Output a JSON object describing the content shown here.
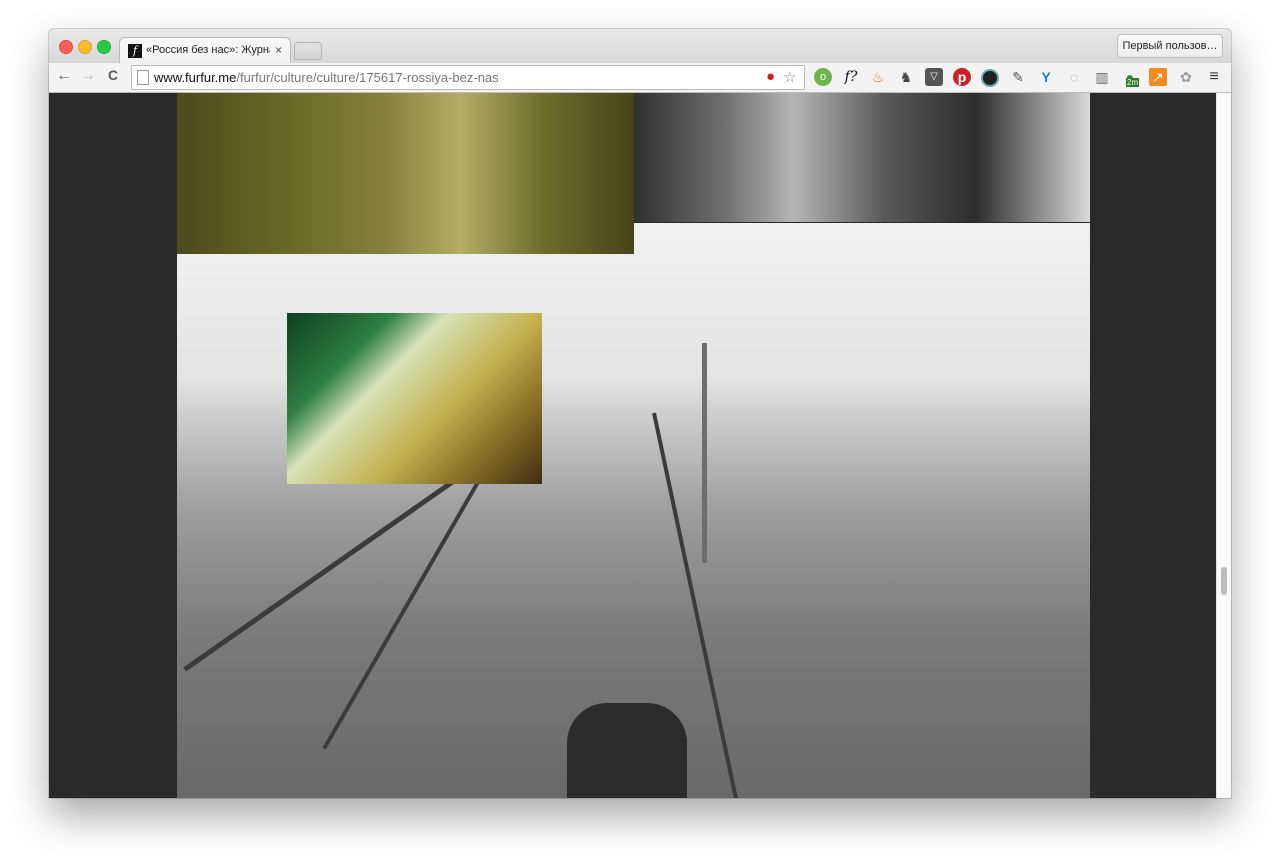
{
  "tab": {
    "title": "«Россия без нас»: Журнал",
    "close": "×",
    "favicon": "f"
  },
  "profile_button": "Первый пользов…",
  "nav": {
    "back": "←",
    "forward": "→",
    "reload": "C"
  },
  "address": {
    "domain": "www.furfur.me",
    "path": "/furfur/culture/culture/175617-rossiya-bez-nas"
  },
  "extensions": {
    "furfur": "f?",
    "badge_2m": "2m"
  },
  "icons": [
    "lastpass-icon",
    "bookmark-star-icon",
    "ghostery-icon",
    "furfur-icon",
    "fire-icon",
    "evernote-icon",
    "pocket-icon",
    "pinterest-icon",
    "camera-icon",
    "eyedropper-icon",
    "vimeo-icon",
    "loader-icon",
    "reader-icon",
    "weather-icon",
    "chart-icon",
    "paw-icon",
    "menu-icon"
  ],
  "colors": {
    "pinterest": "#cb2027",
    "pocket": "#ee4056",
    "chart": "#f28b1d",
    "ghostery": "#6eb54c"
  }
}
